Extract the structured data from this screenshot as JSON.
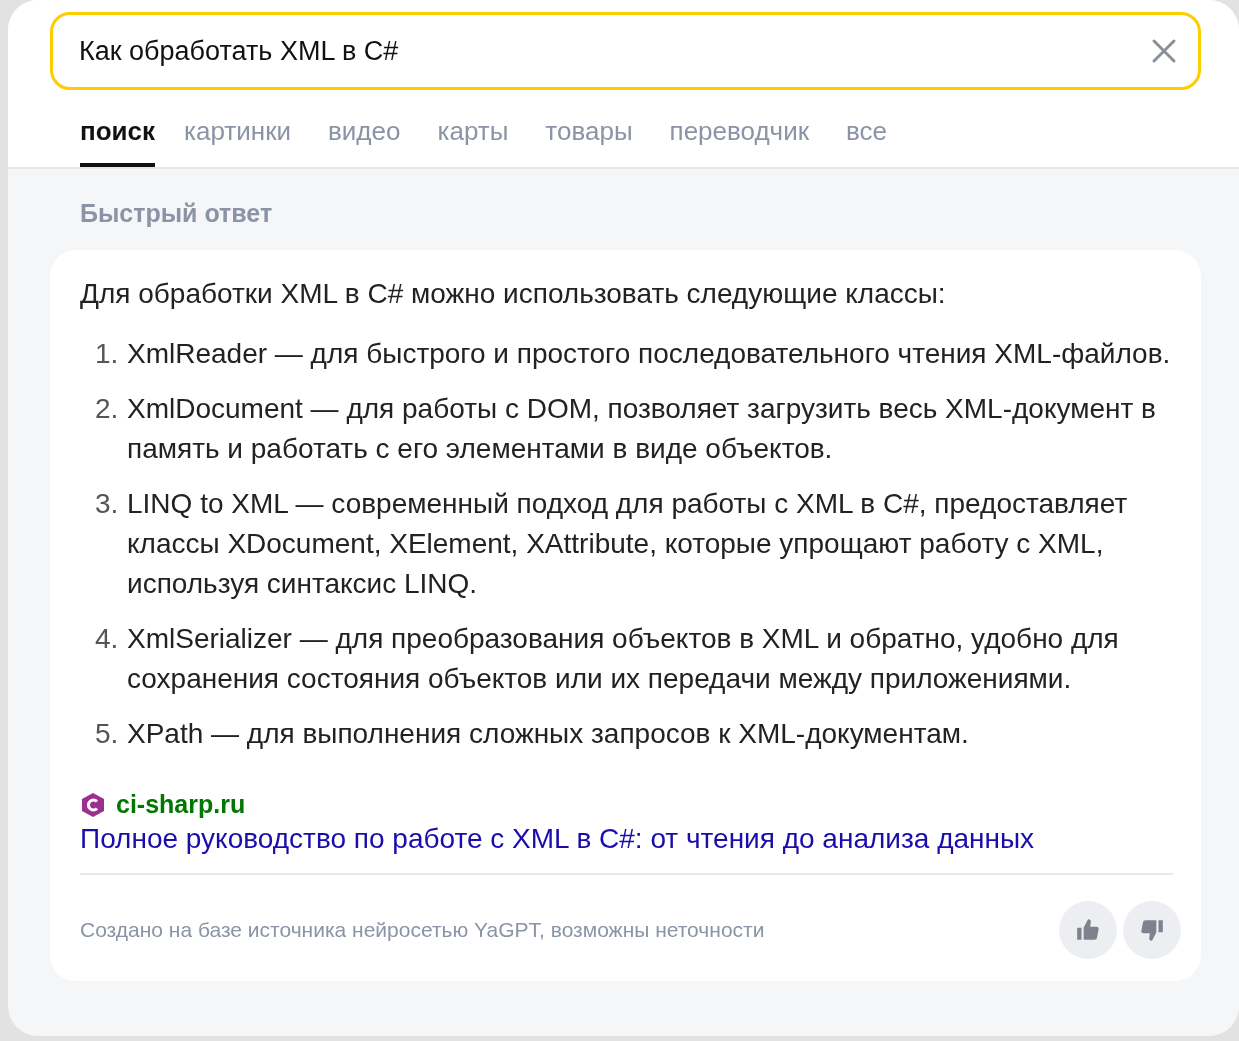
{
  "search": {
    "value": "Как обработать XML в C#"
  },
  "tabs": [
    {
      "label": "поиск",
      "selected": true
    },
    {
      "label": "картинки",
      "selected": false
    },
    {
      "label": "видео",
      "selected": false
    },
    {
      "label": "карты",
      "selected": false
    },
    {
      "label": "товары",
      "selected": false
    },
    {
      "label": "переводчик",
      "selected": false
    },
    {
      "label": "все",
      "selected": false
    }
  ],
  "section_title": "Быстрый ответ",
  "answer": {
    "intro": "Для обработки XML в C# можно использовать следующие классы:",
    "items": [
      {
        "number": "1.",
        "text": "XmlReader — для быстрого и простого последовательного чтения XML-файлов."
      },
      {
        "number": "2.",
        "text": "XmlDocument — для работы с DOM, позволяет загрузить весь XML-документ в память и работать с его элементами в виде объектов."
      },
      {
        "number": "3.",
        "text": "LINQ to XML — современный подход для работы с XML в C#, предоставляет классы XDocument, XElement, XAttribute, которые упрощают работу с XML, используя синтаксис LINQ."
      },
      {
        "number": "4.",
        "text": "XmlSerializer — для преобразования объектов в XML и обратно, удобно для сохранения состояния объектов или их передачи между приложениями."
      },
      {
        "number": "5.",
        "text": "XPath — для выполнения сложных запросов к XML-документам."
      }
    ],
    "source": {
      "site": "ci-sharp.ru",
      "title": "Полное руководство по работе с XML в C#: от чтения до анализа данных"
    },
    "disclaimer": "Создано на базе источника нейросетью YaGPT, возможны неточности"
  }
}
